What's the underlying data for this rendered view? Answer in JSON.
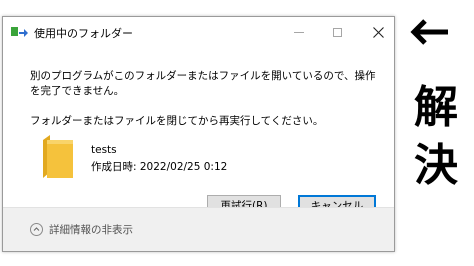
{
  "window": {
    "title": "使用中のフォルダー",
    "close_glyph": "✕"
  },
  "message": {
    "line1": "別のプログラムがこのフォルダーまたはファイルを開いているので、操作を完了できません。",
    "line2": "フォルダーまたはファイルを閉じてから再実行してください。"
  },
  "file": {
    "name": "tests",
    "created": "作成日時: 2022/02/25 0:12"
  },
  "buttons": {
    "retry": "再試行(R)",
    "cancel": "キャンセル"
  },
  "footer": {
    "details_label": "詳細情報の非表示"
  },
  "annotation": {
    "char1": "解",
    "char2": "決"
  },
  "colors": {
    "folder": "#f5c23c",
    "focus_border": "#0078d7",
    "app_icon_green": "#3aa43a",
    "app_icon_blue": "#2f6fcf"
  }
}
